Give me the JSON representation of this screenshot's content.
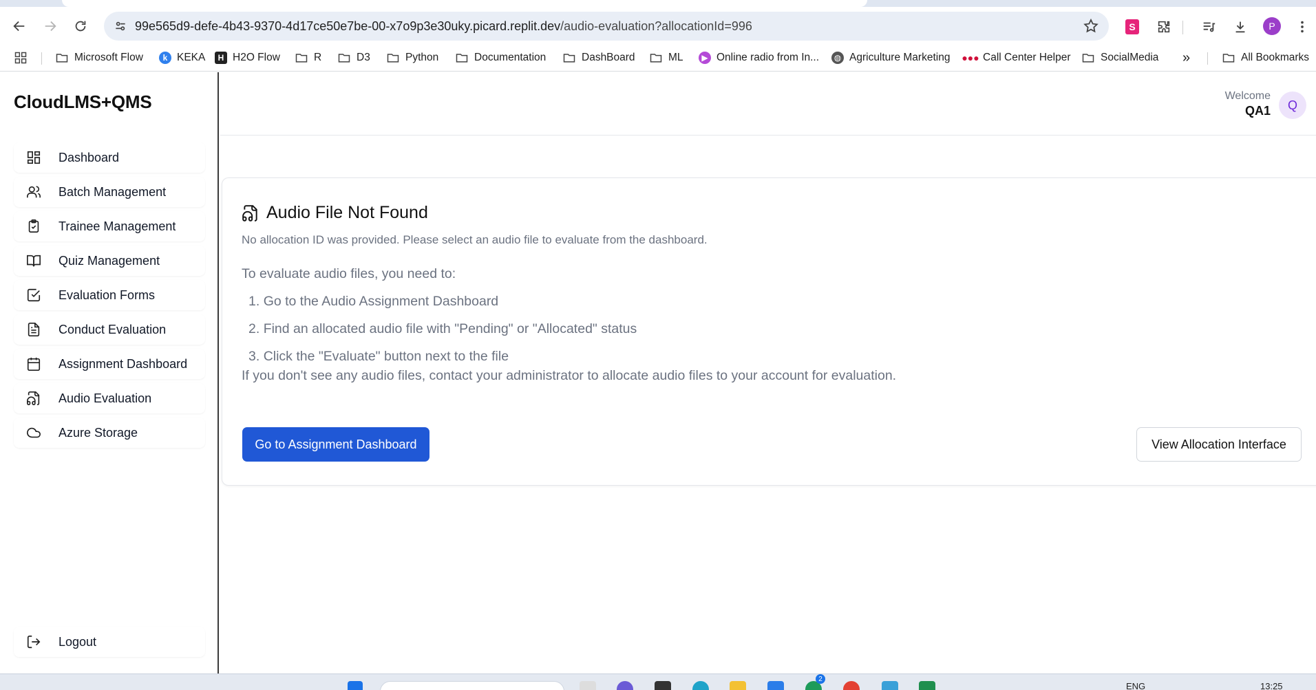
{
  "browser": {
    "url_host": "99e565d9-defe-4b43-9370-4d17ce50e7be-00-x7o9p3e30uky.picard.replit.dev",
    "url_path": "/audio-evaluation?allocationId=996",
    "profile_initial": "P",
    "bookmarks": [
      {
        "label": "Microsoft Flow",
        "icon": "folder-icon"
      },
      {
        "label": "KEKA",
        "icon": "keka-icon"
      },
      {
        "label": "H2O Flow",
        "icon": "h2o-icon"
      },
      {
        "label": "R",
        "icon": "folder-icon"
      },
      {
        "label": "D3",
        "icon": "folder-icon"
      },
      {
        "label": "Python",
        "icon": "folder-icon"
      },
      {
        "label": "Documentation",
        "icon": "folder-icon"
      },
      {
        "label": "DashBoard",
        "icon": "folder-icon"
      },
      {
        "label": "ML",
        "icon": "folder-icon"
      },
      {
        "label": "Online radio from In...",
        "icon": "radio-icon"
      },
      {
        "label": "Agriculture Marketing",
        "icon": "globe-icon"
      },
      {
        "label": "Call Center Helper",
        "icon": "callcenter-icon"
      },
      {
        "label": "SocialMedia",
        "icon": "folder-icon"
      }
    ],
    "overflow_label": "»",
    "all_bookmarks": "All Bookmarks"
  },
  "app": {
    "brand": "CloudLMS+QMS",
    "nav": [
      {
        "label": "Dashboard",
        "icon": "dashboard-icon"
      },
      {
        "label": "Batch Management",
        "icon": "users-icon"
      },
      {
        "label": "Trainee Management",
        "icon": "clipboard-check-icon"
      },
      {
        "label": "Quiz Management",
        "icon": "book-open-icon"
      },
      {
        "label": "Evaluation Forms",
        "icon": "check-square-icon"
      },
      {
        "label": "Conduct Evaluation",
        "icon": "file-text-icon"
      },
      {
        "label": "Assignment Dashboard",
        "icon": "calendar-icon"
      },
      {
        "label": "Audio Evaluation",
        "icon": "file-audio-icon"
      },
      {
        "label": "Azure Storage",
        "icon": "cloud-icon"
      }
    ],
    "logout": "Logout",
    "header": {
      "welcome": "Welcome",
      "user": "QA1",
      "avatar_initial": "Q"
    },
    "card": {
      "title": "Audio File Not Found",
      "subtitle": "No allocation ID was provided. Please select an audio file to evaluate from the dashboard.",
      "intro": "To evaluate audio files, you need to:",
      "steps": [
        "Go to the Audio Assignment Dashboard",
        "Find an allocated audio file with \"Pending\" or \"Allocated\" status",
        "Click the \"Evaluate\" button next to the file"
      ],
      "note": "If you don't see any audio files, contact your administrator to allocate audio files to your account for evaluation.",
      "primary_button": "Go to Assignment Dashboard",
      "secondary_button": "View Allocation Interface"
    },
    "colors": {
      "primary": "#2058d6",
      "avatar_bg": "#ede3fb",
      "avatar_fg": "#6d28d9"
    }
  },
  "taskbar": {
    "language": "ENG",
    "time": "13:25",
    "badge_count": "2"
  }
}
